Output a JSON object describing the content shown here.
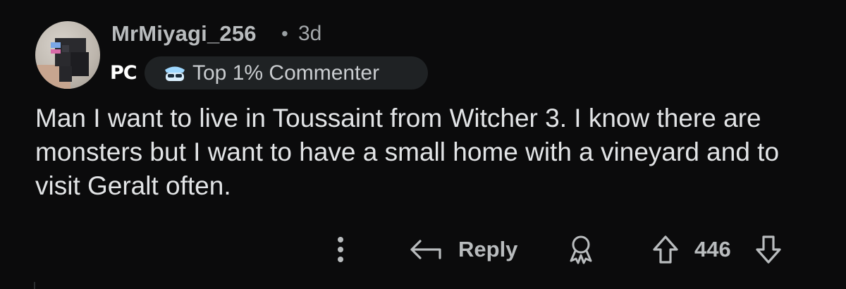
{
  "comment": {
    "author": "MrMiyagi_256",
    "separator": "•",
    "age": "3d",
    "user_flair": "PC",
    "badge": {
      "label": "Top 1% Commenter",
      "icon": "top-commenter-icon"
    },
    "body": "Man I want to live in Toussaint from Witcher 3. I know there are monsters but I want to have a small home with a vineyard and to visit Geralt often."
  },
  "actions": {
    "more_icon": "more-vertical-icon",
    "reply_label": "Reply",
    "reply_icon": "reply-arrow-icon",
    "award_icon": "award-icon",
    "upvote_icon": "upvote-arrow-icon",
    "score": "446",
    "downvote_icon": "downvote-arrow-icon"
  },
  "colors": {
    "background": "#0b0b0c",
    "text": "#e2e4e6",
    "muted": "#b9bcbe",
    "badge_bg": "#1f2224"
  }
}
